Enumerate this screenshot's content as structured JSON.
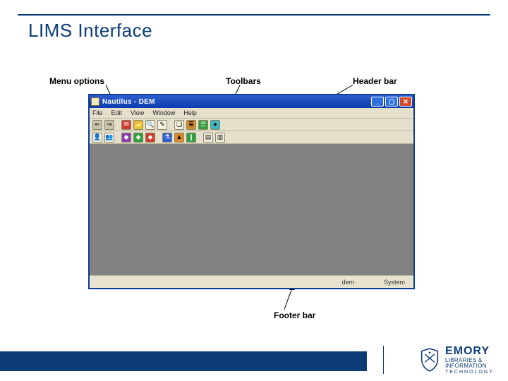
{
  "slide": {
    "title": "LIMS Interface"
  },
  "callouts": {
    "menu_options": "Menu options",
    "toolbars": "Toolbars",
    "header_bar": "Header bar",
    "footer_bar": "Footer bar"
  },
  "window": {
    "title": "Nautilus - DEM",
    "menubar": [
      "File",
      "Edit",
      "View",
      "Window",
      "Help"
    ],
    "toolbar1_icons": [
      "back-icon",
      "forward-icon",
      "mail-icon",
      "open-icon",
      "search-icon",
      "print-icon",
      "chart-icon",
      "report-icon",
      "tree-icon",
      "globe-icon"
    ],
    "toolbar2_icons": [
      "user-icon",
      "users-icon",
      "cube-purple-icon",
      "cube-green-icon",
      "cube-red-icon",
      "flask-icon",
      "beaker-icon",
      "tube-icon",
      "gap",
      "sheet1-icon",
      "sheet2-icon"
    ],
    "status": {
      "left": "",
      "mid": "dem",
      "right": "System"
    }
  },
  "brand": {
    "name": "EMORY",
    "line1": "LIBRARIES &",
    "line2": "INFORMATION",
    "line3": "TECHNOLOGY"
  }
}
